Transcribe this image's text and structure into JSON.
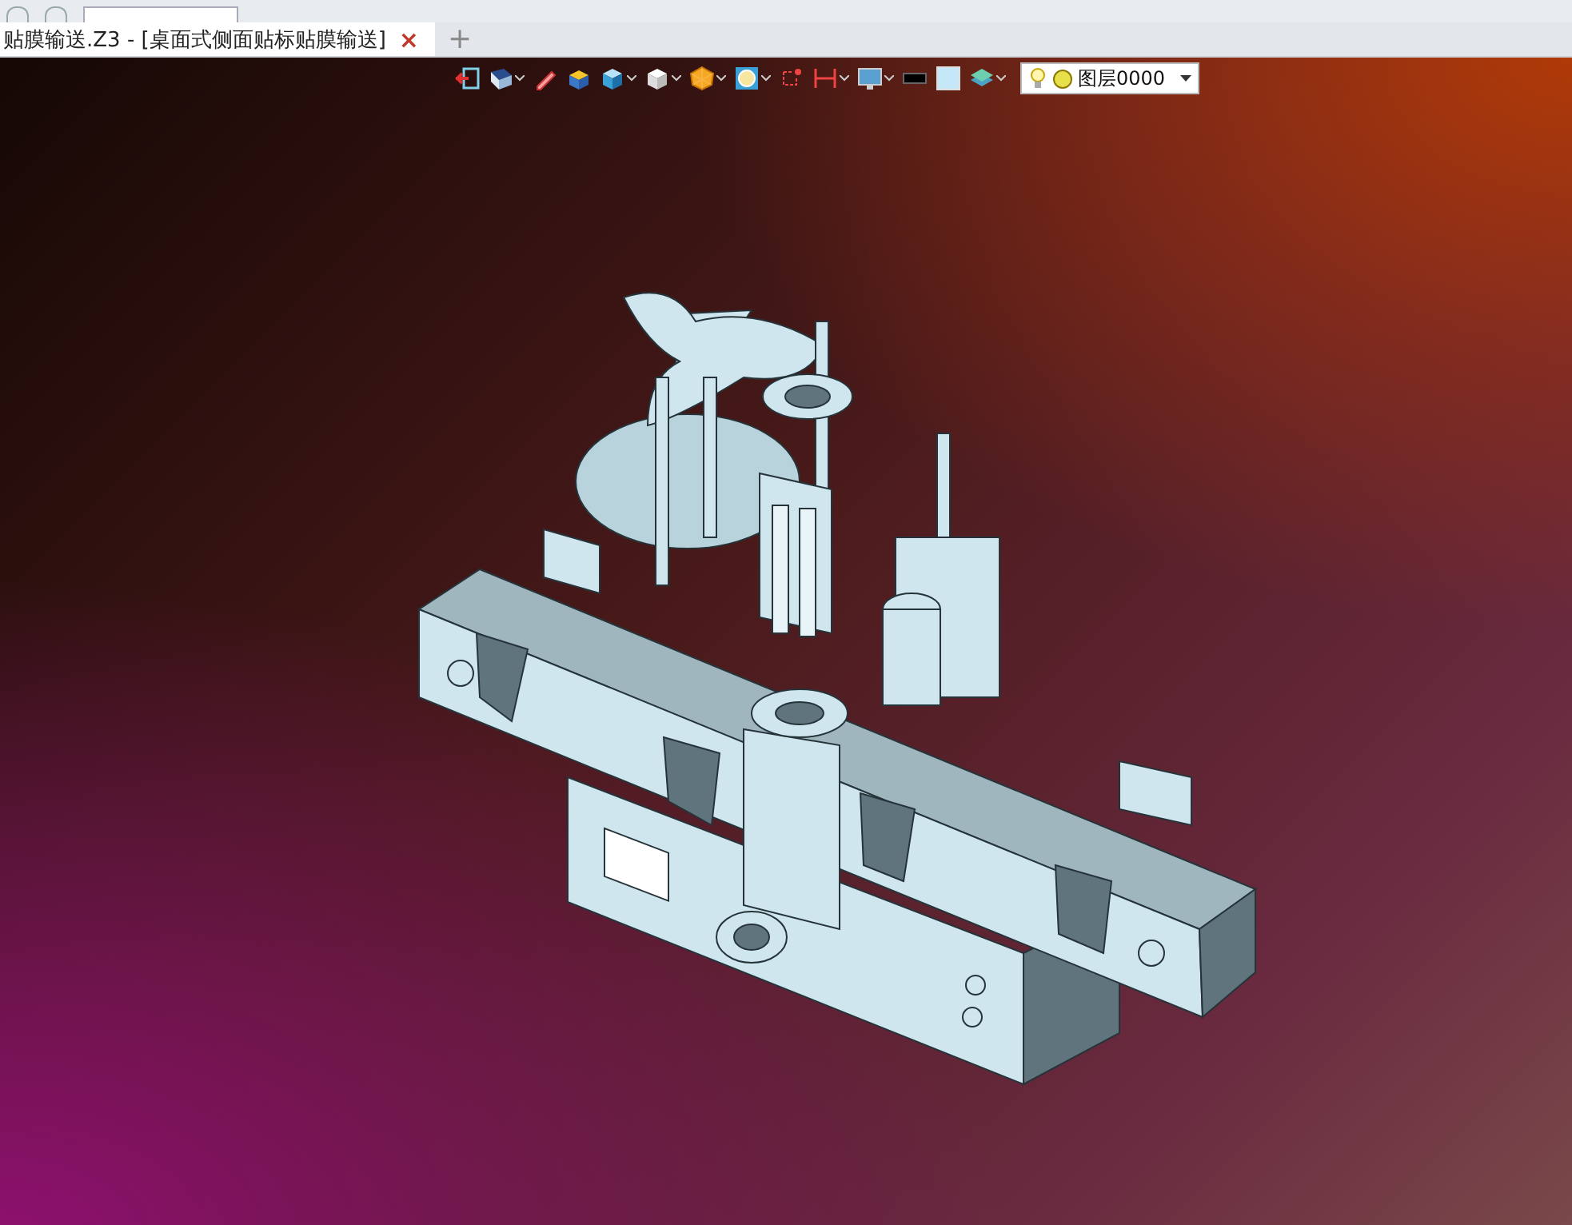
{
  "tabs": [
    {
      "title": "贴膜输送.Z3 - [桌面式侧面贴标贴膜输送]",
      "close": "×",
      "selected": true
    }
  ],
  "new_tab": "+",
  "view_toolbar": [
    {
      "kind": "exit",
      "menu": false
    },
    {
      "kind": "view",
      "menu": true
    },
    {
      "kind": "pencil",
      "menu": false
    },
    {
      "kind": "box-top",
      "menu": false
    },
    {
      "kind": "box-shaded",
      "menu": true
    },
    {
      "kind": "box-white",
      "menu": true
    },
    {
      "kind": "sphere",
      "menu": true
    },
    {
      "kind": "zoom",
      "menu": true
    },
    {
      "kind": "pick",
      "menu": false
    },
    {
      "kind": "dimension",
      "menu": true
    },
    {
      "kind": "screen",
      "menu": true
    },
    {
      "kind": "black-swatch",
      "menu": false
    },
    {
      "kind": "blue-swatch",
      "menu": false
    },
    {
      "kind": "layers",
      "menu": true
    }
  ],
  "layer_dropdown": {
    "value": "图层0000"
  }
}
